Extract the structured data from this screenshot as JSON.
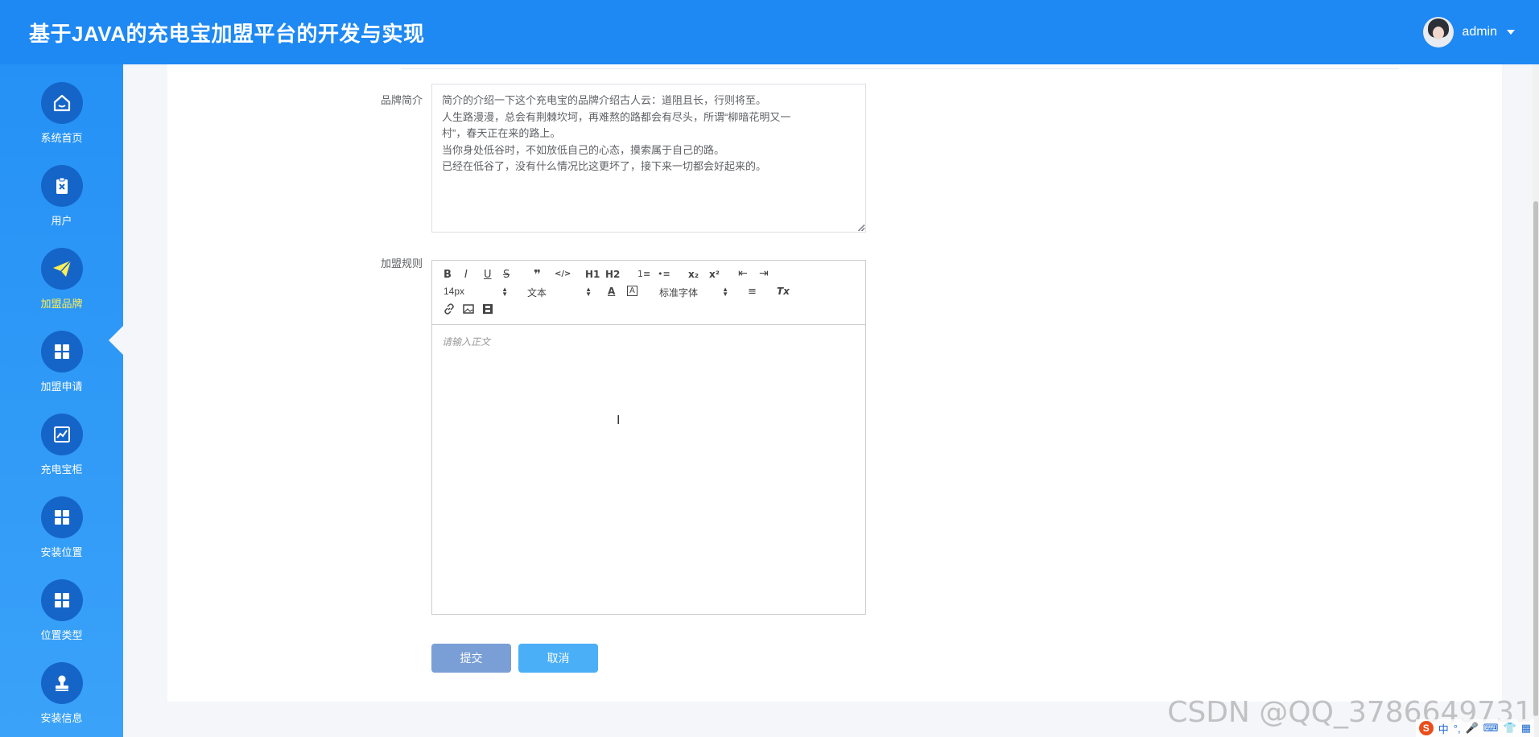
{
  "header": {
    "title": "基于JAVA的充电宝加盟平台的开发与实现",
    "username": "admin"
  },
  "sidebar": {
    "items": [
      {
        "label": "系统首页",
        "icon": "home-icon",
        "active": false
      },
      {
        "label": "用户",
        "icon": "clipboard-icon",
        "active": false
      },
      {
        "label": "加盟品牌",
        "icon": "paper-plane-icon",
        "active": true
      },
      {
        "label": "加盟申请",
        "icon": "grid-icon",
        "active": false
      },
      {
        "label": "充电宝柜",
        "icon": "chart-icon",
        "active": false
      },
      {
        "label": "安装位置",
        "icon": "grid-icon",
        "active": false
      },
      {
        "label": "位置类型",
        "icon": "grid-icon",
        "active": false
      },
      {
        "label": "安装信息",
        "icon": "stamp-icon",
        "active": false
      }
    ]
  },
  "form": {
    "brand_intro_label": "品牌简介",
    "brand_intro_value": "简介的介绍一下这个充电宝的品牌介绍古人云：道阻且长，行则将至。\n人生路漫漫，总会有荆棘坎坷，再难熬的路都会有尽头，所谓“柳暗花明又一\n村”，春天正在来的路上。\n当你身处低谷时，不如放低自己的心态，摸索属于自己的路。\n已经在低谷了，没有什么情况比这更坏了，接下来一切都会好起来的。",
    "rules_label": "加盟规则",
    "editor_placeholder": "请输入正文",
    "submit_label": "提交",
    "cancel_label": "取消"
  },
  "editor_toolbar": {
    "font_size": "14px",
    "header_select": "文本",
    "font_family": "标准字体",
    "buttons": {
      "bold": "B",
      "italic": "I",
      "underline": "U",
      "strike": "S",
      "blockquote": "❞",
      "code": "</>",
      "h1": "H1",
      "h2": "H2",
      "ordered_list": "1≡",
      "bullet_list": "•≡",
      "subscript": "x₂",
      "superscript": "x²",
      "outdent": "⇤",
      "indent": "⇥",
      "color": "A",
      "background": "A",
      "align": "≡",
      "clean": "Tx",
      "link": "🔗",
      "image": "▣",
      "video": "▤"
    }
  },
  "watermark": "CSDN @QQ_3786649731",
  "tray": {
    "lang": "中"
  }
}
